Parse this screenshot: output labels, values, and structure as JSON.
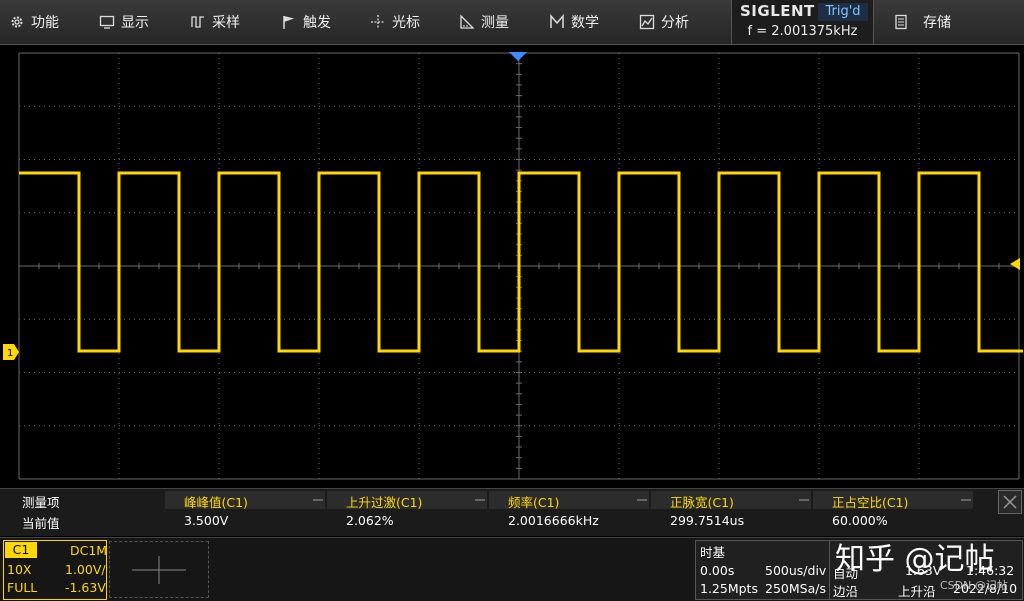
{
  "menu": [
    {
      "label": "功能",
      "icon": "gear-icon"
    },
    {
      "label": "显示",
      "icon": "monitor-icon"
    },
    {
      "label": "采样",
      "icon": "sample-icon"
    },
    {
      "label": "触发",
      "icon": "flag-icon"
    },
    {
      "label": "光标",
      "icon": "crosshair-icon"
    },
    {
      "label": "测量",
      "icon": "ruler-icon"
    },
    {
      "label": "数学",
      "icon": "math-icon"
    },
    {
      "label": "分析",
      "icon": "analysis-icon"
    }
  ],
  "brand": "SIGLENT",
  "trigger_status": "Trig'd",
  "frequency_readout": "f = 2.001375kHz",
  "save_label": "存储",
  "colors": {
    "trace": "#ffd800",
    "grid": "#6a6a6a",
    "trigger_marker": "#3b8cff",
    "measure_text": "#ffd800"
  },
  "waveform": {
    "type": "square",
    "periods_on_screen": 10,
    "duty_cycle": 0.6,
    "first_edge": "rising",
    "ground_marker": "1",
    "trigger_marker": "T"
  },
  "measurements": {
    "row_header": "测量项",
    "row_value_label": "当前值",
    "items": [
      {
        "name": "峰峰值(C1)",
        "value": "3.500V"
      },
      {
        "name": "上升过激(C1)",
        "value": "2.062%"
      },
      {
        "name": "频率(C1)",
        "value": "2.0016666kHz"
      },
      {
        "name": "正脉宽(C1)",
        "value": "299.7514us"
      },
      {
        "name": "正占空比(C1)",
        "value": "60.000%"
      }
    ]
  },
  "channel": {
    "name": "C1",
    "coupling": "DC1M",
    "probe": "10X",
    "scale": "1.00V/",
    "bandwidth": "FULL",
    "offset": "-1.63V"
  },
  "timebase": {
    "title": "时基",
    "delay": "0.00s",
    "scale": "500us/div",
    "memory": "1.25Mpts",
    "sample_rate": "250MSa/s"
  },
  "trigger": {
    "mode": "自动",
    "type": "边沿",
    "level": "1.63V",
    "slope": "上升沿",
    "time": "1:46:32",
    "date": "2022/8/10"
  },
  "watermark": "知乎 @记帖",
  "watermark_small": "CSDN @记帖"
}
